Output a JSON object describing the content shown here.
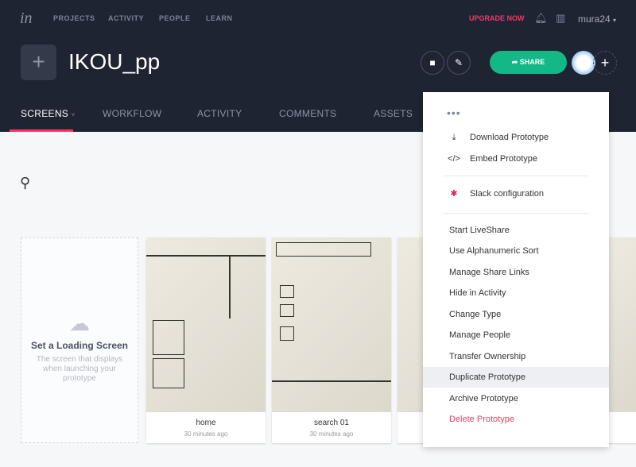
{
  "topnav": {
    "logo": "in",
    "items": [
      "PROJECTS",
      "ACTIVITY",
      "PEOPLE",
      "LEARN"
    ],
    "upgrade": "UPGRADE NOW",
    "user": "mura24"
  },
  "project": {
    "title": "IKOU_pp",
    "share": "SHARE"
  },
  "tabs": [
    "SCREENS",
    "WORKFLOW",
    "ACTIVITY",
    "COMMENTS",
    "ASSETS"
  ],
  "loading": {
    "title": "Set a Loading Screen",
    "desc": "The screen that displays when launching your prototype"
  },
  "screens": [
    {
      "name": "home",
      "time": "30 minutes ago"
    },
    {
      "name": "search 01",
      "time": "30 minutes ago"
    }
  ],
  "menu": {
    "dots": "•••",
    "top": [
      {
        "label": "Download Prototype",
        "icon": "download-icon"
      },
      {
        "label": "Embed Prototype",
        "icon": "code-icon"
      }
    ],
    "slack": "Slack configuration",
    "items": [
      "Start LiveShare",
      "Use Alphanumeric Sort",
      "Manage Share Links",
      "Hide in Activity",
      "Change Type",
      "Manage People",
      "Transfer Ownership",
      "Duplicate Prototype",
      "Archive Prototype",
      "Delete Prototype"
    ]
  },
  "colors": {
    "accent": "#ff3366",
    "share": "#12b886",
    "nav_bg": "#1f2433",
    "delete": "#e5445c"
  }
}
